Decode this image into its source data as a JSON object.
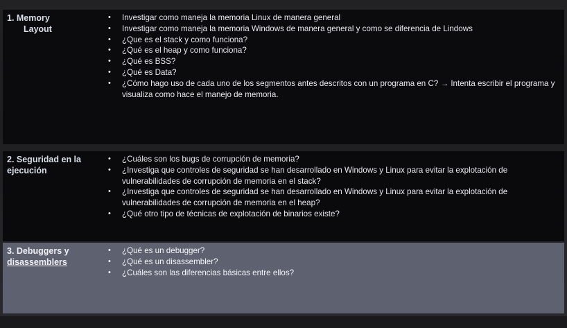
{
  "rows": [
    {
      "topic_line1": "1.   Memory",
      "topic_line2": "Layout",
      "bullets": [
        "Investigar como maneja la memoria Linux de manera general",
        "Investigar como maneja la memoria Windows de manera general y como se diferencia de Lindows",
        "¿Que es el stack y como funciona?",
        "¿Qué es el heap y como funciona?",
        "¿Qué es BSS?",
        "¿Qué es Data?",
        "¿Cómo hago uso de cada uno de los segmentos antes descritos con un programa  en C? → Intenta escribir el programa y visualiza como hace el manejo de memoria."
      ]
    },
    {
      "topic_line1": "2. Seguridad en la",
      "topic_line2": "ejecución",
      "bullets": [
        "¿Cuáles  son los bugs de corrupción de memoria?",
        "¿Investiga que controles de seguridad  se han desarrollado en Windows y Linux para evitar la explotación de vulnerabilidades de corrupción de memoria en el stack?",
        "¿Investiga que controles de seguridad  se han desarrollado en Windows y Linux para evitar la explotación de vulnerabilidades de corrupción de memoria en el heap?",
        "¿Qué otro tipo de técnicas de explotación de binarios existe?"
      ]
    },
    {
      "topic_line1": "3. Debuggers y",
      "topic_line2": "disassemblers",
      "bullets": [
        "¿Qué es un debugger?",
        "¿Qué es un disassembler?",
        "¿Cuáles son las diferencias básicas entre ellos?"
      ]
    }
  ],
  "bullet_glyph": "•"
}
